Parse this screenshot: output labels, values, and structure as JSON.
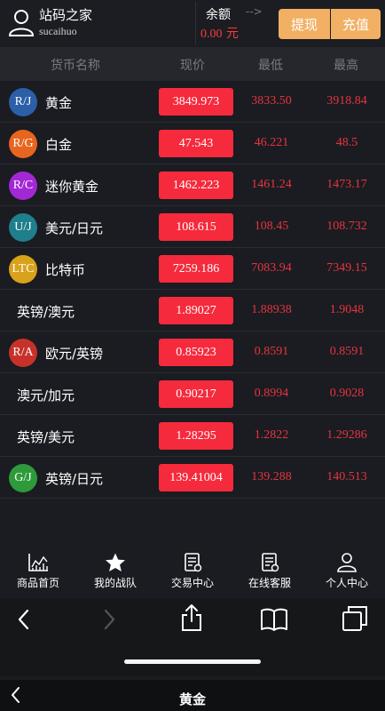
{
  "header": {
    "site_name": "站码之家",
    "user_id": "sucaihuo",
    "balance_label": "余额",
    "balance_arrow": "-->",
    "balance_amount": "0.00",
    "balance_unit": "元",
    "withdraw_label": "提现",
    "deposit_label": "充值"
  },
  "columns": {
    "name": "货币名称",
    "price": "现价",
    "low": "最低",
    "high": "最高"
  },
  "rows": [
    {
      "badge": "R/J",
      "badge_color": "#2b5fa8",
      "name": "黄金",
      "price": "3849.973",
      "low": "3833.50",
      "high": "3918.84"
    },
    {
      "badge": "R/G",
      "badge_color": "#e8651f",
      "name": "白金",
      "price": "47.543",
      "low": "46.221",
      "high": "48.5"
    },
    {
      "badge": "R/C",
      "badge_color": "#a427d6",
      "name": "迷你黄金",
      "price": "1462.223",
      "low": "1461.24",
      "high": "1473.17"
    },
    {
      "badge": "U/J",
      "badge_color": "#1f7f8c",
      "name": "美元/日元",
      "price": "108.615",
      "low": "108.45",
      "high": "108.732"
    },
    {
      "badge": "LTC",
      "badge_color": "#d9a21b",
      "name": "比特币",
      "price": "7259.186",
      "low": "7083.94",
      "high": "7349.15"
    },
    {
      "badge": "",
      "badge_color": "",
      "name": "英镑/澳元",
      "price": "1.89027",
      "low": "1.88938",
      "high": "1.9048"
    },
    {
      "badge": "R/A",
      "badge_color": "#c7312a",
      "name": "欧元/英镑",
      "price": "0.85923",
      "low": "0.8591",
      "high": "0.8591"
    },
    {
      "badge": "",
      "badge_color": "",
      "name": "澳元/加元",
      "price": "0.90217",
      "low": "0.8994",
      "high": "0.9028"
    },
    {
      "badge": "",
      "badge_color": "",
      "name": "英镑/美元",
      "price": "1.28295",
      "low": "1.2822",
      "high": "1.29286"
    },
    {
      "badge": "G/J",
      "badge_color": "#2f9a3a",
      "name": "英镑/日元",
      "price": "139.41004",
      "low": "139.288",
      "high": "140.513"
    }
  ],
  "tabs": [
    {
      "label": "商品首页",
      "icon": "chart-icon"
    },
    {
      "label": "我的战队",
      "icon": "star-icon"
    },
    {
      "label": "交易中心",
      "icon": "document-icon"
    },
    {
      "label": "在线客服",
      "icon": "document-icon"
    },
    {
      "label": "个人中心",
      "icon": "person-icon"
    }
  ],
  "browser": {
    "icons": [
      "back-icon",
      "forward-icon",
      "share-icon",
      "bookmarks-icon",
      "tabs-icon"
    ]
  },
  "title_bar": {
    "title": "黄金"
  },
  "colors": {
    "price_bg": "#f52a3c",
    "low_high_text": "#e8343f",
    "button_orange": "#f2b064",
    "balance_red": "#ff3b3b"
  }
}
